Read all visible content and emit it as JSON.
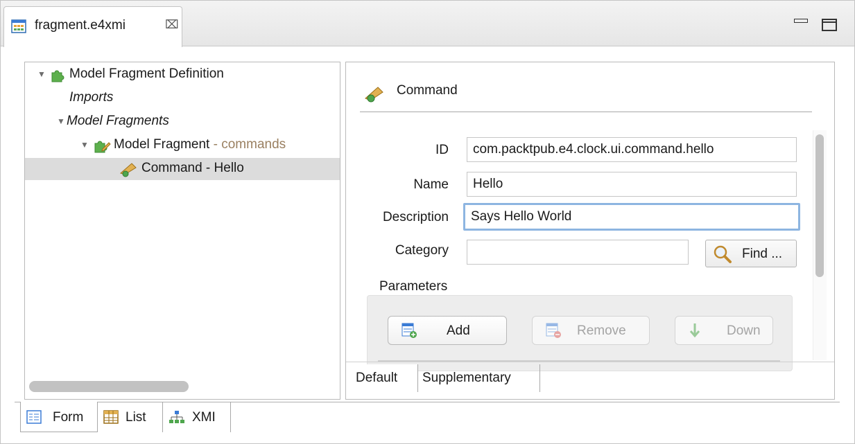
{
  "editor_tab": {
    "title": "fragment.e4xmi",
    "close": "⌧"
  },
  "tree": {
    "items": [
      {
        "label": "Model Fragment Definition"
      },
      {
        "label": "Imports"
      },
      {
        "label": "Model Fragments"
      },
      {
        "label": "Model Fragment",
        "suffix": "- commands"
      },
      {
        "label": "Command - Hello",
        "selected": true
      }
    ]
  },
  "detail": {
    "title": "Command",
    "fields": {
      "id": {
        "label": "ID",
        "value": "com.packtpub.e4.clock.ui.command.hello"
      },
      "name": {
        "label": "Name",
        "value": "Hello"
      },
      "description": {
        "label": "Description",
        "value": "Says Hello World"
      },
      "category": {
        "label": "Category",
        "value": ""
      }
    },
    "find_label": "Find ...",
    "parameters_label": "Parameters",
    "buttons": {
      "add": "Add",
      "remove": "Remove",
      "down": "Down"
    },
    "tabs": {
      "default": "Default",
      "supplementary": "Supplementary"
    }
  },
  "bottom_tabs": {
    "form": "Form",
    "list": "List",
    "xmi": "XMI"
  },
  "colors": {
    "focus": "#8db5e1",
    "selected_row": "#dcdcdc",
    "suffix": "#9a8061"
  }
}
